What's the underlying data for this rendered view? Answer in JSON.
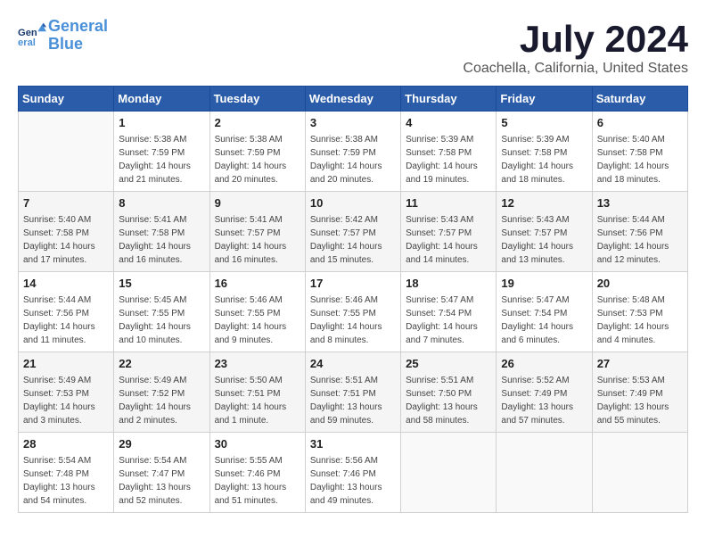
{
  "logo": {
    "line1": "General",
    "line2": "Blue"
  },
  "title": "July 2024",
  "subtitle": "Coachella, California, United States",
  "headers": [
    "Sunday",
    "Monday",
    "Tuesday",
    "Wednesday",
    "Thursday",
    "Friday",
    "Saturday"
  ],
  "weeks": [
    [
      {
        "day": "",
        "info": ""
      },
      {
        "day": "1",
        "info": "Sunrise: 5:38 AM\nSunset: 7:59 PM\nDaylight: 14 hours\nand 21 minutes."
      },
      {
        "day": "2",
        "info": "Sunrise: 5:38 AM\nSunset: 7:59 PM\nDaylight: 14 hours\nand 20 minutes."
      },
      {
        "day": "3",
        "info": "Sunrise: 5:38 AM\nSunset: 7:59 PM\nDaylight: 14 hours\nand 20 minutes."
      },
      {
        "day": "4",
        "info": "Sunrise: 5:39 AM\nSunset: 7:58 PM\nDaylight: 14 hours\nand 19 minutes."
      },
      {
        "day": "5",
        "info": "Sunrise: 5:39 AM\nSunset: 7:58 PM\nDaylight: 14 hours\nand 18 minutes."
      },
      {
        "day": "6",
        "info": "Sunrise: 5:40 AM\nSunset: 7:58 PM\nDaylight: 14 hours\nand 18 minutes."
      }
    ],
    [
      {
        "day": "7",
        "info": "Sunrise: 5:40 AM\nSunset: 7:58 PM\nDaylight: 14 hours\nand 17 minutes."
      },
      {
        "day": "8",
        "info": "Sunrise: 5:41 AM\nSunset: 7:58 PM\nDaylight: 14 hours\nand 16 minutes."
      },
      {
        "day": "9",
        "info": "Sunrise: 5:41 AM\nSunset: 7:57 PM\nDaylight: 14 hours\nand 16 minutes."
      },
      {
        "day": "10",
        "info": "Sunrise: 5:42 AM\nSunset: 7:57 PM\nDaylight: 14 hours\nand 15 minutes."
      },
      {
        "day": "11",
        "info": "Sunrise: 5:43 AM\nSunset: 7:57 PM\nDaylight: 14 hours\nand 14 minutes."
      },
      {
        "day": "12",
        "info": "Sunrise: 5:43 AM\nSunset: 7:57 PM\nDaylight: 14 hours\nand 13 minutes."
      },
      {
        "day": "13",
        "info": "Sunrise: 5:44 AM\nSunset: 7:56 PM\nDaylight: 14 hours\nand 12 minutes."
      }
    ],
    [
      {
        "day": "14",
        "info": "Sunrise: 5:44 AM\nSunset: 7:56 PM\nDaylight: 14 hours\nand 11 minutes."
      },
      {
        "day": "15",
        "info": "Sunrise: 5:45 AM\nSunset: 7:55 PM\nDaylight: 14 hours\nand 10 minutes."
      },
      {
        "day": "16",
        "info": "Sunrise: 5:46 AM\nSunset: 7:55 PM\nDaylight: 14 hours\nand 9 minutes."
      },
      {
        "day": "17",
        "info": "Sunrise: 5:46 AM\nSunset: 7:55 PM\nDaylight: 14 hours\nand 8 minutes."
      },
      {
        "day": "18",
        "info": "Sunrise: 5:47 AM\nSunset: 7:54 PM\nDaylight: 14 hours\nand 7 minutes."
      },
      {
        "day": "19",
        "info": "Sunrise: 5:47 AM\nSunset: 7:54 PM\nDaylight: 14 hours\nand 6 minutes."
      },
      {
        "day": "20",
        "info": "Sunrise: 5:48 AM\nSunset: 7:53 PM\nDaylight: 14 hours\nand 4 minutes."
      }
    ],
    [
      {
        "day": "21",
        "info": "Sunrise: 5:49 AM\nSunset: 7:53 PM\nDaylight: 14 hours\nand 3 minutes."
      },
      {
        "day": "22",
        "info": "Sunrise: 5:49 AM\nSunset: 7:52 PM\nDaylight: 14 hours\nand 2 minutes."
      },
      {
        "day": "23",
        "info": "Sunrise: 5:50 AM\nSunset: 7:51 PM\nDaylight: 14 hours\nand 1 minute."
      },
      {
        "day": "24",
        "info": "Sunrise: 5:51 AM\nSunset: 7:51 PM\nDaylight: 13 hours\nand 59 minutes."
      },
      {
        "day": "25",
        "info": "Sunrise: 5:51 AM\nSunset: 7:50 PM\nDaylight: 13 hours\nand 58 minutes."
      },
      {
        "day": "26",
        "info": "Sunrise: 5:52 AM\nSunset: 7:49 PM\nDaylight: 13 hours\nand 57 minutes."
      },
      {
        "day": "27",
        "info": "Sunrise: 5:53 AM\nSunset: 7:49 PM\nDaylight: 13 hours\nand 55 minutes."
      }
    ],
    [
      {
        "day": "28",
        "info": "Sunrise: 5:54 AM\nSunset: 7:48 PM\nDaylight: 13 hours\nand 54 minutes."
      },
      {
        "day": "29",
        "info": "Sunrise: 5:54 AM\nSunset: 7:47 PM\nDaylight: 13 hours\nand 52 minutes."
      },
      {
        "day": "30",
        "info": "Sunrise: 5:55 AM\nSunset: 7:46 PM\nDaylight: 13 hours\nand 51 minutes."
      },
      {
        "day": "31",
        "info": "Sunrise: 5:56 AM\nSunset: 7:46 PM\nDaylight: 13 hours\nand 49 minutes."
      },
      {
        "day": "",
        "info": ""
      },
      {
        "day": "",
        "info": ""
      },
      {
        "day": "",
        "info": ""
      }
    ]
  ]
}
